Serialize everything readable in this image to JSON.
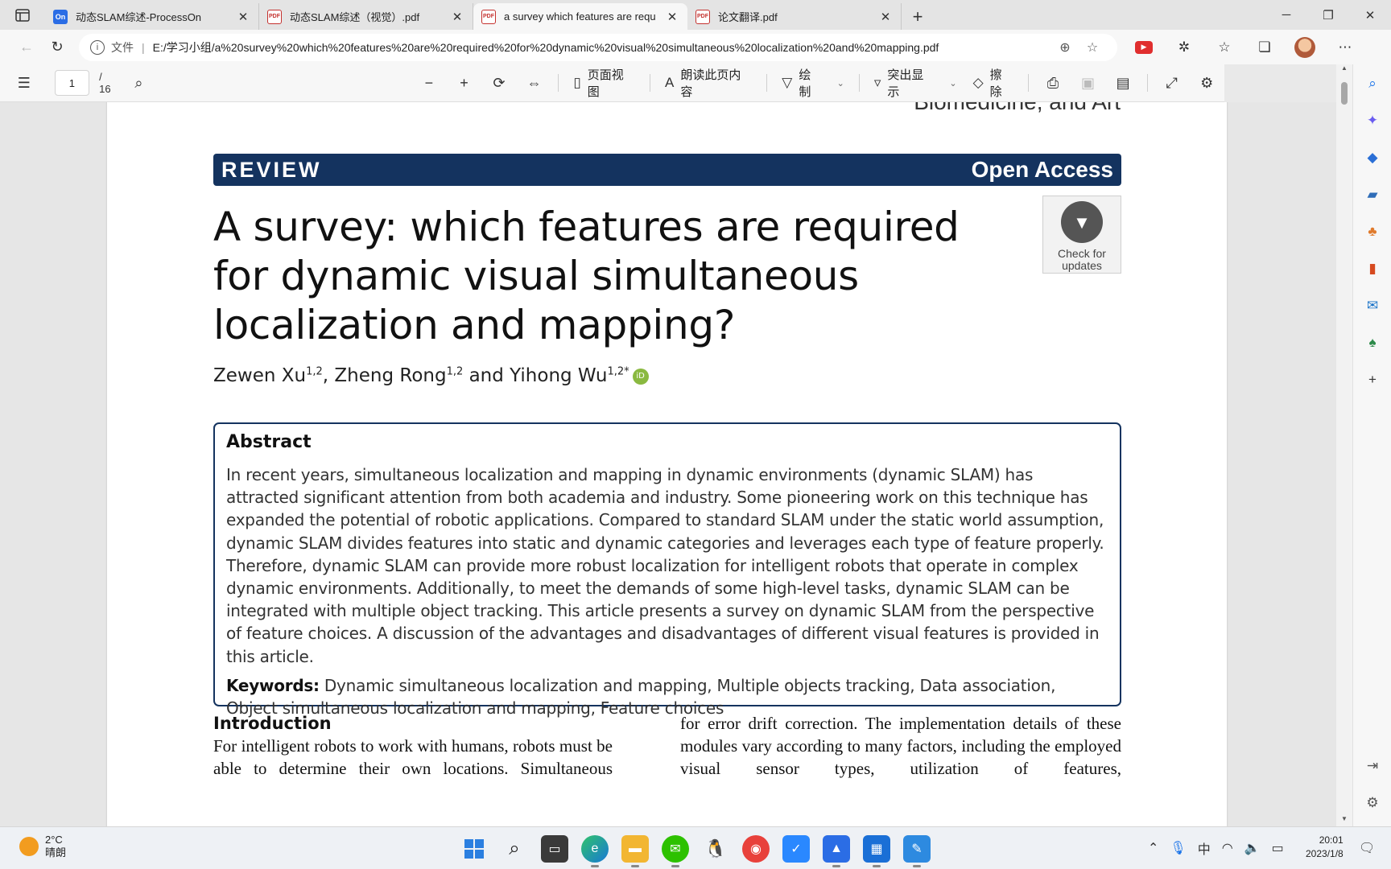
{
  "tabs": [
    {
      "title": "动态SLAM综述-ProcessOn",
      "icon": "processon-icon",
      "favicon_text": "On",
      "active": false
    },
    {
      "title": "动态SLAM综述（视觉）.pdf",
      "icon": "pdf-icon",
      "favicon_text": "PDF",
      "active": false
    },
    {
      "title": "a survey which features are requ",
      "icon": "pdf-icon",
      "favicon_text": "PDF",
      "active": true
    },
    {
      "title": "论文翻译.pdf",
      "icon": "pdf-icon",
      "favicon_text": "PDF",
      "active": false
    }
  ],
  "address": {
    "scheme_label": "文件",
    "url": "E:/学习小组/a%20survey%20which%20features%20are%20required%20for%20dynamic%20visual%20simultaneous%20localization%20and%20mapping.pdf"
  },
  "pdf_toolbar": {
    "page_current": "1",
    "page_total": "/ 16",
    "page_view_label": "页面视图",
    "read_aloud_label": "朗读此页内容",
    "draw_label": "绘制",
    "highlight_label": "突出显示",
    "erase_label": "擦除"
  },
  "document": {
    "journal_fragment": "Biomedicine, and Art",
    "banner_left": "REVIEW",
    "banner_right": "Open Access",
    "title": "A survey: which features are required for dynamic visual simultaneous localization and mapping?",
    "check_updates": "Check for updates",
    "authors": [
      {
        "name": "Zewen Xu",
        "sup": "1,2"
      },
      {
        "name": "Zheng Rong",
        "sup": "1,2"
      },
      {
        "name": "Yihong Wu",
        "sup": "1,2*"
      }
    ],
    "author_and": "and",
    "abstract_heading": "Abstract",
    "abstract_text": "In recent years, simultaneous localization and mapping in dynamic environments (dynamic SLAM) has attracted significant attention from both academia and industry. Some pioneering work on this technique has expanded the potential of robotic applications. Compared to standard SLAM under the static world assumption, dynamic SLAM divides features into static and dynamic categories and leverages each type of feature properly. Therefore, dynamic SLAM can provide more robust localization for intelligent robots that operate in complex dynamic environments. Additionally, to meet the demands of some high-level tasks, dynamic SLAM can be integrated with multiple object tracking. This article presents a survey on dynamic SLAM from the perspective of feature choices. A discussion of the advantages and disadvantages of different visual features is provided in this article.",
    "keywords_label": "Keywords:",
    "keywords_text": "Dynamic simultaneous localization and mapping, Multiple objects tracking, Data association, Object simultaneous localization and mapping, Feature choices",
    "intro_heading": "Introduction",
    "left_col_text": "For intelligent robots to work with humans, robots must be able to determine their own locations. Simultaneous",
    "right_col_text": "for error drift correction. The implementation details of these modules vary according to many factors, including the employed visual sensor types, utilization of features,"
  },
  "taskbar": {
    "temperature": "2°C",
    "weather": "晴朗",
    "ime": "中",
    "time": "20:01",
    "date": "2023/1/8"
  },
  "colors": {
    "banner": "#14335f",
    "accent_blue": "#1a73e8"
  }
}
